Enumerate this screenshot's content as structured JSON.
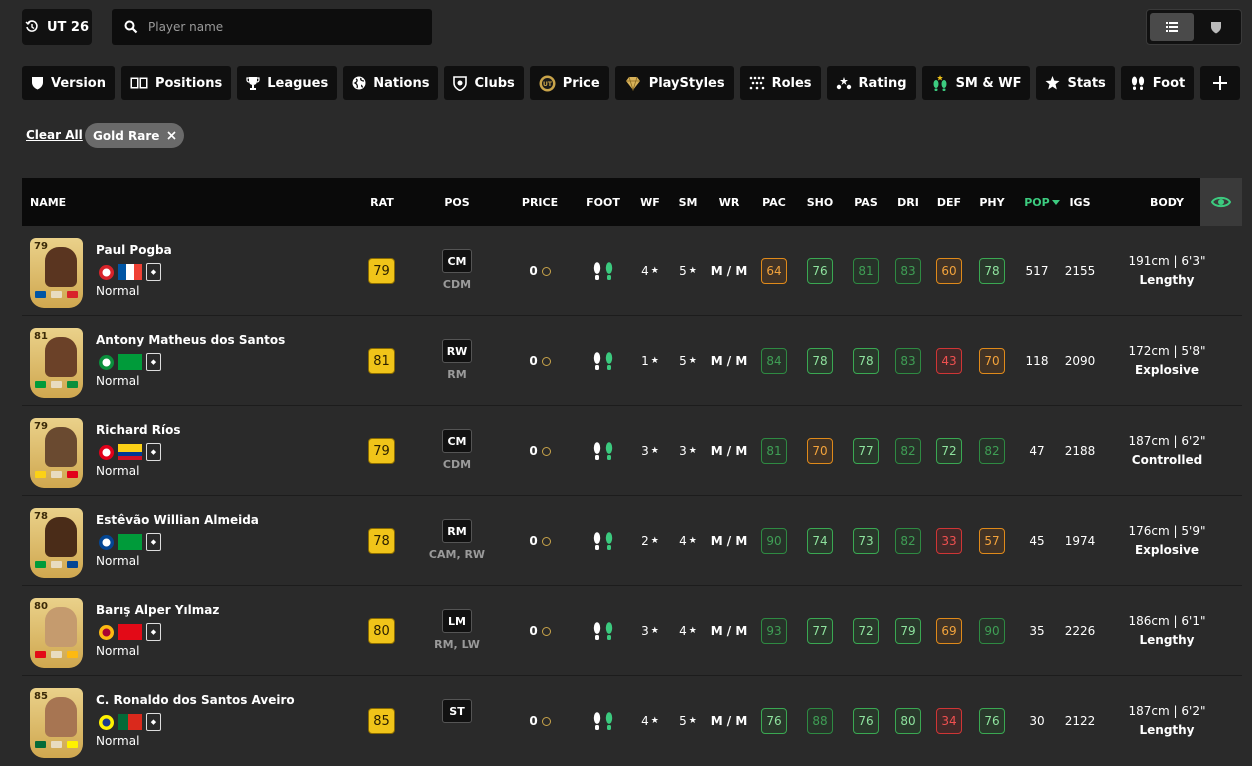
{
  "header": {
    "version_label": "UT 26",
    "search_placeholder": "Player name"
  },
  "filters": [
    "Version",
    "Positions",
    "Leagues",
    "Nations",
    "Clubs",
    "Price",
    "PlayStyles",
    "Roles",
    "Rating",
    "SM & WF",
    "Stats",
    "Foot"
  ],
  "active_filters": {
    "clear_label": "Clear All",
    "chips": [
      "Gold Rare"
    ]
  },
  "table": {
    "columns": {
      "name": "NAME",
      "rat": "RAT",
      "pos": "POS",
      "price": "PRICE",
      "foot": "FOOT",
      "wf": "WF",
      "sm": "SM",
      "wr": "WR",
      "pac": "PAC",
      "sho": "SHO",
      "pas": "PAS",
      "dri": "DRI",
      "def": "DEF",
      "phy": "PHY",
      "pop": "POP",
      "igs": "IGS",
      "body": "BODY"
    },
    "rows": [
      {
        "card_rating": "79",
        "name": "Paul Pogba",
        "type": "Normal",
        "rating": "79",
        "pos": "CM",
        "alt_pos": "CDM",
        "price": "0",
        "wf": "4",
        "sm": "5",
        "wr": "M / M",
        "pac": "64",
        "sho": "76",
        "pas": "81",
        "dri": "83",
        "def": "60",
        "phy": "78",
        "pop": "517",
        "igs": "2155",
        "height": "191cm | 6'3\"",
        "build": "Lengthy",
        "club_colors": [
          "#d8232a",
          "#ffffff"
        ],
        "flag_colors": [
          "#0055a4",
          "#ffffff",
          "#ef4135"
        ],
        "flag_dir": "v"
      },
      {
        "card_rating": "81",
        "name": "Antony Matheus dos Santos",
        "type": "Normal",
        "rating": "81",
        "pos": "RW",
        "alt_pos": "RM",
        "price": "0",
        "wf": "1",
        "sm": "5",
        "wr": "M / M",
        "pac": "84",
        "sho": "78",
        "pas": "78",
        "dri": "83",
        "def": "43",
        "phy": "70",
        "pop": "118",
        "igs": "2090",
        "height": "172cm | 5'8\"",
        "build": "Explosive",
        "club_colors": [
          "#0a8f3c",
          "#ffffff"
        ],
        "flag_colors": [
          "#009b3a",
          "#fedf00",
          "#002776"
        ],
        "flag_dir": "br"
      },
      {
        "card_rating": "79",
        "name": "Richard Ríos",
        "type": "Normal",
        "rating": "79",
        "pos": "CM",
        "alt_pos": "CDM",
        "price": "0",
        "wf": "3",
        "sm": "3",
        "wr": "M / M",
        "pac": "81",
        "sho": "70",
        "pas": "77",
        "dri": "82",
        "def": "72",
        "phy": "82",
        "pop": "47",
        "igs": "2188",
        "height": "187cm | 6'2\"",
        "build": "Controlled",
        "club_colors": [
          "#e2001a",
          "#ffffff"
        ],
        "flag_colors": [
          "#fcd116",
          "#003893",
          "#ce1126"
        ],
        "flag_dir": "h"
      },
      {
        "card_rating": "78",
        "name": "Estêvão Willian Almeida",
        "type": "Normal",
        "rating": "78",
        "pos": "RM",
        "alt_pos": "CAM, RW",
        "price": "0",
        "wf": "2",
        "sm": "4",
        "wr": "M / M",
        "pac": "90",
        "sho": "74",
        "pas": "73",
        "dri": "82",
        "def": "33",
        "phy": "57",
        "pop": "45",
        "igs": "1974",
        "height": "176cm | 5'9\"",
        "build": "Explosive",
        "club_colors": [
          "#034694",
          "#ffffff"
        ],
        "flag_colors": [
          "#009b3a",
          "#fedf00",
          "#002776"
        ],
        "flag_dir": "br"
      },
      {
        "card_rating": "80",
        "name": "Barış Alper Yılmaz",
        "type": "Normal",
        "rating": "80",
        "pos": "LM",
        "alt_pos": "RM, LW",
        "price": "0",
        "wf": "3",
        "sm": "4",
        "wr": "M / M",
        "pac": "93",
        "sho": "77",
        "pas": "72",
        "dri": "79",
        "def": "69",
        "phy": "90",
        "pop": "35",
        "igs": "2226",
        "height": "186cm | 6'1\"",
        "build": "Lengthy",
        "club_colors": [
          "#fdb912",
          "#a90432"
        ],
        "flag_colors": [
          "#e30a17",
          "#ffffff",
          "#e30a17"
        ],
        "flag_dir": "tr"
      },
      {
        "card_rating": "85",
        "name": "C. Ronaldo dos Santos Aveiro",
        "type": "Normal",
        "rating": "85",
        "pos": "ST",
        "alt_pos": "",
        "price": "0",
        "wf": "4",
        "sm": "5",
        "wr": "M / M",
        "pac": "76",
        "sho": "88",
        "pas": "76",
        "dri": "80",
        "def": "34",
        "phy": "76",
        "pop": "30",
        "igs": "2122",
        "height": "187cm | 6'2\"",
        "build": "Lengthy",
        "club_colors": [
          "#fff200",
          "#1e3a8a"
        ],
        "flag_colors": [
          "#046a38",
          "#da291c",
          "#da291c"
        ],
        "flag_dir": "pt"
      }
    ],
    "stat_colors": {
      "r0": [
        "o",
        "g1",
        "g2",
        "g2",
        "o",
        "g1"
      ],
      "r1": [
        "g2",
        "g1",
        "g1",
        "g2",
        "r",
        "o"
      ],
      "r2": [
        "g2",
        "o",
        "g1",
        "g2",
        "g1",
        "g2"
      ],
      "r3": [
        "g2",
        "g1",
        "g1",
        "g2",
        "r",
        "o"
      ],
      "r4": [
        "g2",
        "g1",
        "g1",
        "g1",
        "o",
        "g2"
      ],
      "r5": [
        "g1",
        "g2",
        "g1",
        "g1",
        "r",
        "g1"
      ]
    }
  },
  "colors": {
    "accent": "#3ccb7f",
    "rating_gold": "#f0c419",
    "background": "#2a2a2a",
    "header_bg": "#0a0a0a"
  }
}
